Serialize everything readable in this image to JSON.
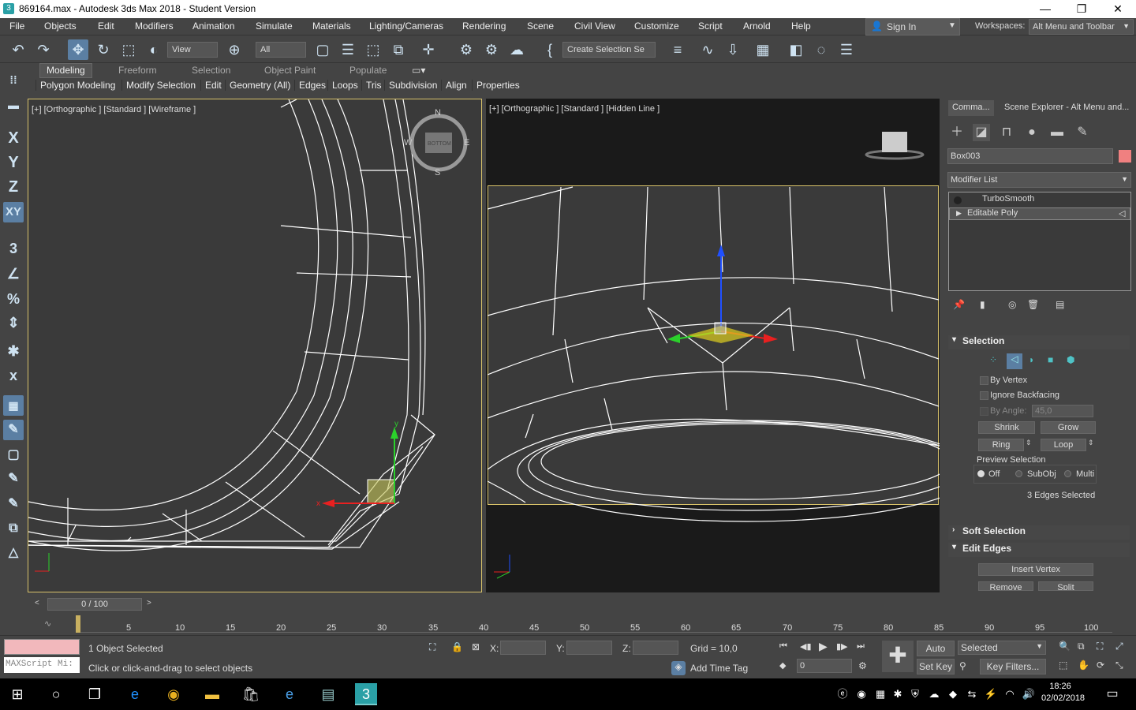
{
  "window": {
    "title": "869164.max - Autodesk 3ds Max 2018 - Student Version",
    "minimize": "—",
    "maximize": "❐",
    "close": "✕"
  },
  "menu": [
    "File",
    "Objects",
    "Edit",
    "Modifiers",
    "Animation",
    "Simulate",
    "Materials",
    "Lighting/Cameras",
    "Rendering",
    "Scene",
    "Civil View",
    "Customize",
    "Script",
    "Arnold",
    "Help"
  ],
  "signin": "Sign In",
  "workspaces": {
    "label": "Workspaces:",
    "value": "Alt Menu and Toolbar"
  },
  "toolbar": {
    "view_select": "View",
    "filter_select": "All",
    "selection_set": "Create Selection Se"
  },
  "ribbon_tabs": [
    "Modeling",
    "Freeform",
    "Selection",
    "Object Paint",
    "Populate"
  ],
  "ribbon_items": [
    "Polygon Modeling",
    "Modify Selection",
    "Edit",
    "Geometry (All)",
    "Edges",
    "Loops",
    "Tris",
    "Subdivision",
    "Align",
    "Properties"
  ],
  "left_tools": [
    "X",
    "Y",
    "Z",
    "XY"
  ],
  "viewport1": {
    "label": "[+] [Orthographic ] [Standard ] [Wireframe ]",
    "cube_label": "BOTTOM",
    "compass": [
      "N",
      "E",
      "S",
      "W"
    ]
  },
  "viewport2": {
    "label": "[+] [Orthographic ] [Standard ] [Hidden Line ]"
  },
  "command_panel": {
    "tabs": [
      "Comma...",
      "Scene Explorer - Alt Menu and..."
    ],
    "object_name": "Box003",
    "object_color": "#f08080",
    "modifier_list": "Modifier List",
    "stack": [
      "TurboSmooth",
      "Editable Poly"
    ],
    "selection": {
      "title": "Selection",
      "by_vertex": "By Vertex",
      "ignore_backfacing": "Ignore Backfacing",
      "by_angle": "By Angle:",
      "angle_value": "45,0",
      "shrink": "Shrink",
      "grow": "Grow",
      "ring": "Ring",
      "loop": "Loop",
      "preview_title": "Preview Selection",
      "preview_options": [
        "Off",
        "SubObj",
        "Multi"
      ],
      "status": "3 Edges Selected"
    },
    "soft_selection": "Soft Selection",
    "edit_edges": {
      "title": "Edit Edges",
      "insert_vertex": "Insert Vertex",
      "remove": "Remove",
      "split": "Split"
    }
  },
  "timeline": {
    "slider": "0 / 100",
    "ticks": [
      "5",
      "10",
      "15",
      "20",
      "25",
      "30",
      "35",
      "40",
      "45",
      "50",
      "55",
      "60",
      "65",
      "70",
      "75",
      "80",
      "85",
      "90",
      "95",
      "100"
    ]
  },
  "status": {
    "selected": "1 Object Selected",
    "prompt": "Click or click-and-drag to select objects",
    "maxscript": "MAXScript Mi:",
    "x": "X:",
    "y": "Y:",
    "z": "Z:",
    "grid": "Grid = 10,0",
    "add_time_tag": "Add Time Tag",
    "auto_key": "Auto Key",
    "set_key": "Set Key",
    "key_mode": "Selected",
    "key_filters": "Key Filters...",
    "frame": "0"
  },
  "taskbar": {
    "time": "18:26",
    "date": "02/02/2018"
  }
}
